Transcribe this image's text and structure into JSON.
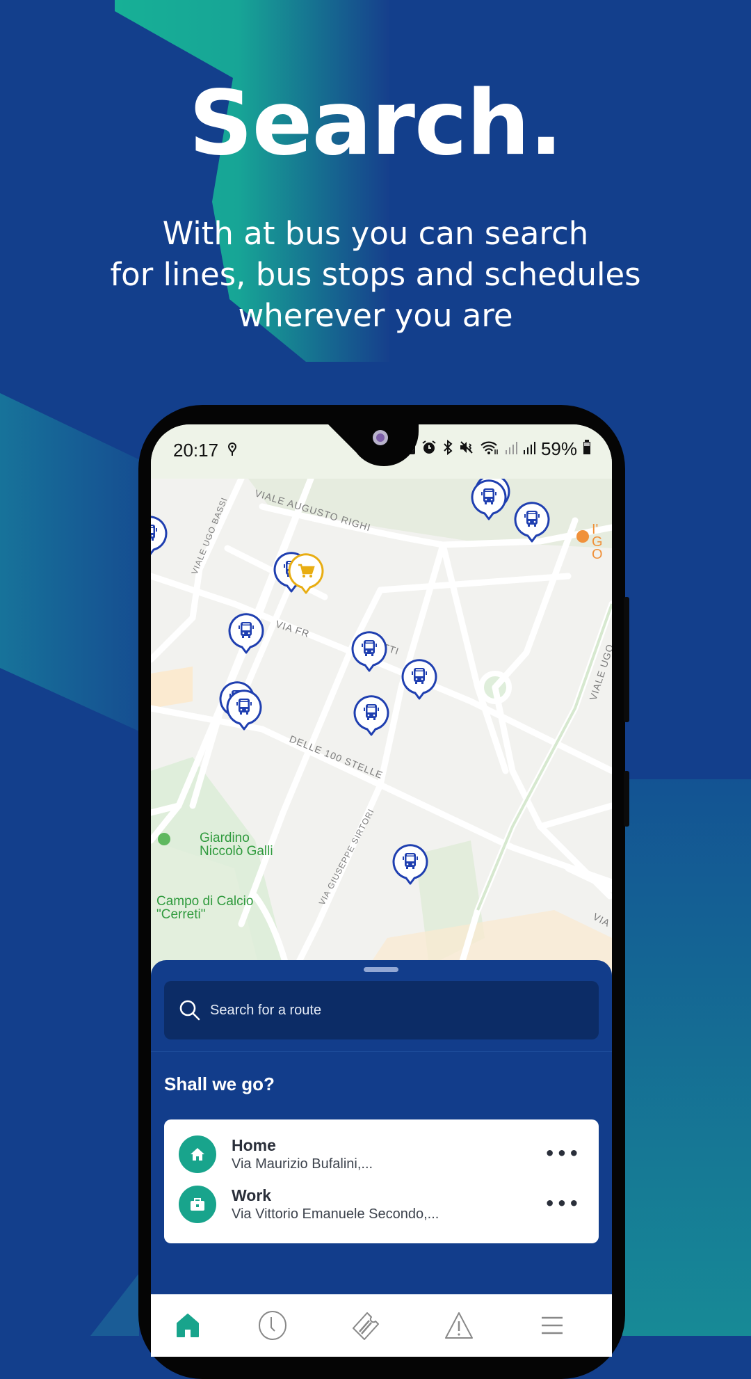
{
  "promo": {
    "title": "Search.",
    "subtitle_lines": [
      "With at bus you can search",
      "for lines, bus stops and schedules",
      "wherever you are"
    ]
  },
  "colors": {
    "background": "#133f8c",
    "accent_teal": "#18a48c",
    "sheet": "#123d8b",
    "search_field": "#0c2c66",
    "bus_stop_pin": "#1f3fb0",
    "shop_pin": "#e8ad12"
  },
  "status_bar": {
    "time": "20:17",
    "location_icon": "location-pin-icon",
    "icons": [
      "battery-saver-icon",
      "alarm-icon",
      "bluetooth-icon",
      "vibrate-icon",
      "wifi-icon",
      "signal-icon",
      "signal-icon"
    ],
    "battery": "59%"
  },
  "map": {
    "street_labels": [
      "VIALE AUGUSTO RIGHI",
      "VIALE UGO BASSI",
      "VIA FR",
      "ZETTI",
      "DELLE 100 STELLE",
      "VIA GIUSEPPE SIRTORI",
      "VIALE UGO",
      "VIA"
    ],
    "poi_labels": [
      {
        "name": "Giardino Niccolò Galli",
        "lines": [
          "Giardino",
          "Niccolò Galli"
        ]
      },
      {
        "name": "Campo di Calcio \"Cerreti\"",
        "lines": [
          "Campo di Calcio",
          "\"Cerreti\""
        ]
      },
      {
        "name": "I' G O",
        "lines": [
          "I' G",
          "O"
        ]
      }
    ],
    "markers": {
      "bus_stop_count": 12,
      "shop_count": 1
    }
  },
  "sheet": {
    "search_placeholder": "Search for a route",
    "section_title": "Shall we go?",
    "favorites": [
      {
        "name": "Home",
        "address": "Via Maurizio Bufalini,...",
        "icon": "home-icon",
        "more": "•••"
      },
      {
        "name": "Work",
        "address": "Via Vittorio Emanuele Secondo,...",
        "icon": "briefcase-icon",
        "more": "•••"
      }
    ]
  },
  "navbar": {
    "items": [
      {
        "name": "home",
        "icon": "home-icon",
        "active": true
      },
      {
        "name": "timetables",
        "icon": "clock-icon",
        "active": false
      },
      {
        "name": "tickets",
        "icon": "ticket-icon",
        "active": false
      },
      {
        "name": "alerts",
        "icon": "warning-icon",
        "active": false
      },
      {
        "name": "menu",
        "icon": "menu-icon",
        "active": false
      }
    ]
  }
}
